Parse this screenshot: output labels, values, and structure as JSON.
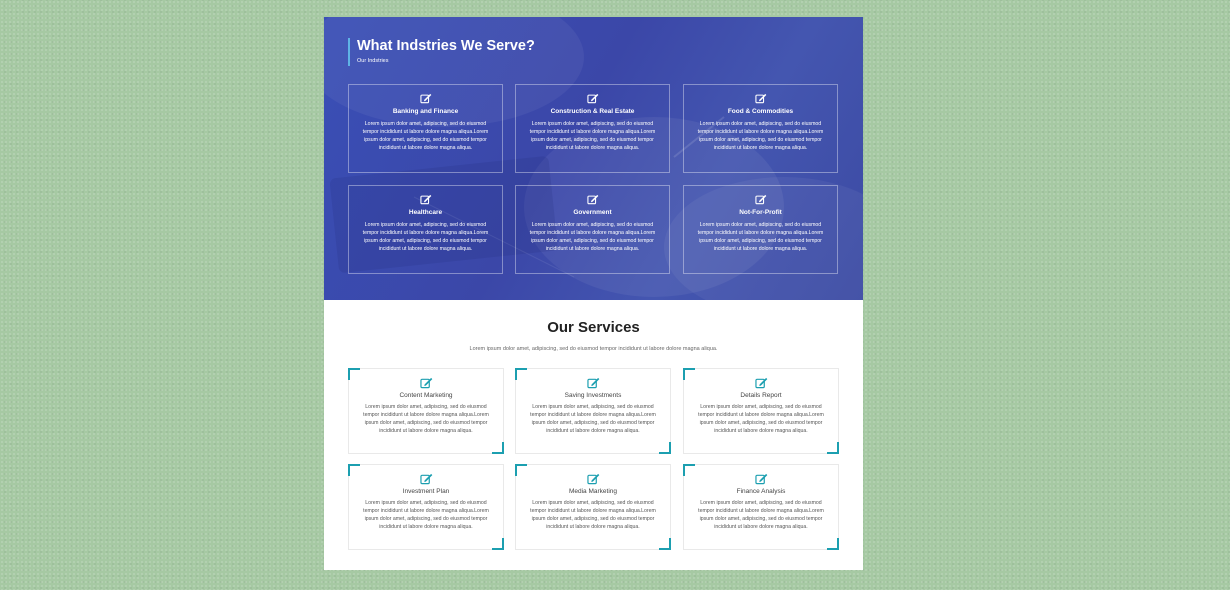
{
  "colors": {
    "background": "#a6c9a3",
    "hero_blue": "#3a4aa8",
    "accent_teal": "#1c9fb0",
    "title_border": "#5fb3e6"
  },
  "industries": {
    "title": "What Indstries We Serve?",
    "subtitle": "Our Indstries",
    "items": [
      {
        "icon": "edit-icon",
        "title": "Banking and Finance",
        "text": "Lorem ipsum dolor amet, adipiscing, sed do eiusmod tempor incididunt ut labore dolore magna aliqua.Lorem ipsum dolor amet, adipiscing, sed do eiusmod tempor incididunt ut labore dolore magna aliqua."
      },
      {
        "icon": "edit-icon",
        "title": "Construction & Real Estate",
        "text": "Lorem ipsum dolor amet, adipiscing, sed do eiusmod tempor incididunt ut labore dolore magna aliqua.Lorem ipsum dolor amet, adipiscing, sed do eiusmod tempor incididunt ut labore dolore magna aliqua."
      },
      {
        "icon": "edit-icon",
        "title": "Food & Commodities",
        "text": "Lorem ipsum dolor amet, adipiscing, sed do eiusmod tempor incididunt ut labore dolore magna aliqua.Lorem ipsum dolor amet, adipiscing, sed do eiusmod tempor incididunt ut labore dolore magna aliqua."
      },
      {
        "icon": "edit-icon",
        "title": "Healthcare",
        "text": "Lorem ipsum dolor amet, adipiscing, sed do eiusmod tempor incididunt ut labore dolore magna aliqua.Lorem ipsum dolor amet, adipiscing, sed do eiusmod tempor incididunt ut labore dolore magna aliqua."
      },
      {
        "icon": "edit-icon",
        "title": "Government",
        "text": "Lorem ipsum dolor amet, adipiscing, sed do eiusmod tempor incididunt ut labore dolore magna aliqua.Lorem ipsum dolor amet, adipiscing, sed do eiusmod tempor incididunt ut labore dolore magna aliqua."
      },
      {
        "icon": "edit-icon",
        "title": "Not-For-Profit",
        "text": "Lorem ipsum dolor amet, adipiscing, sed do eiusmod tempor incididunt ut labore dolore magna aliqua.Lorem ipsum dolor amet, adipiscing, sed do eiusmod tempor incididunt ut labore dolore magna aliqua."
      }
    ]
  },
  "services": {
    "title": "Our Services",
    "subtitle": "Lorem ipsum dolor amet, adipiscing, sed do eiusmod tempor incididunt ut labore dolore magna aliqua.",
    "items": [
      {
        "icon": "edit-icon",
        "title": "Content Marketing",
        "text": "Lorem ipsum dolor amet, adipiscing, sed do eiusmod tempor incididunt ut labore dolore magna aliqua.Lorem ipsum dolor amet, adipiscing, sed do eiusmod tempor incididunt ut labore dolore magna aliqua."
      },
      {
        "icon": "edit-icon",
        "title": "Saving Investments",
        "text": "Lorem ipsum dolor amet, adipiscing, sed do eiusmod tempor incididunt ut labore dolore magna aliqua.Lorem ipsum dolor amet, adipiscing, sed do eiusmod tempor incididunt ut labore dolore magna aliqua."
      },
      {
        "icon": "edit-icon",
        "title": "Details Report",
        "text": "Lorem ipsum dolor amet, adipiscing, sed do eiusmod tempor incididunt ut labore dolore magna aliqua.Lorem ipsum dolor amet, adipiscing, sed do eiusmod tempor incididunt ut labore dolore magna aliqua."
      },
      {
        "icon": "edit-icon",
        "title": "Investment Plan",
        "text": "Lorem ipsum dolor amet, adipiscing, sed do eiusmod tempor incididunt ut labore dolore magna aliqua.Lorem ipsum dolor amet, adipiscing, sed do eiusmod tempor incididunt ut labore dolore magna aliqua."
      },
      {
        "icon": "edit-icon",
        "title": "Media Marketing",
        "text": "Lorem ipsum dolor amet, adipiscing, sed do eiusmod tempor incididunt ut labore dolore magna aliqua.Lorem ipsum dolor amet, adipiscing, sed do eiusmod tempor incididunt ut labore dolore magna aliqua."
      },
      {
        "icon": "edit-icon",
        "title": "Finance Analysis",
        "text": "Lorem ipsum dolor amet, adipiscing, sed do eiusmod tempor incididunt ut labore dolore magna aliqua.Lorem ipsum dolor amet, adipiscing, sed do eiusmod tempor incididunt ut labore dolore magna aliqua."
      }
    ]
  }
}
